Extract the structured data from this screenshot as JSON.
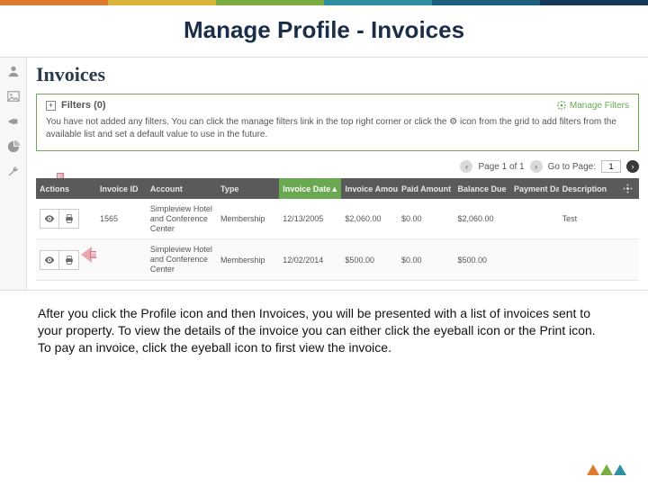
{
  "topbar_colors": [
    "#e07a2d",
    "#d9b43a",
    "#7aac3f",
    "#2f8ea0",
    "#1d5e7e",
    "#153a57"
  ],
  "slide_title": "Manage Profile - Invoices",
  "page_heading": "Invoices",
  "filters": {
    "label": "Filters (0)",
    "manage_label": "Manage Filters",
    "message": "You have not added any filters. You can click the manage filters link in the top right corner or click the ⚙ icon from the grid to add filters from the available list and set a default value to use in the future."
  },
  "paginator": {
    "page_info": "Page 1 of 1",
    "goto_label": "Go to Page:",
    "goto_value": "1"
  },
  "columns": {
    "actions": "Actions",
    "invoice_id": "Invoice ID",
    "account": "Account",
    "type": "Type",
    "invoice_date": "Invoice Date",
    "invoice_amount": "Invoice Amount",
    "paid_amount": "Paid Amount",
    "balance_due": "Balance Due",
    "payment_date": "Payment Date",
    "description": "Description"
  },
  "rows": [
    {
      "invoice_id": "1565",
      "account": "Simpleview Hotel and Conference Center",
      "type": "Membership",
      "invoice_date": "12/13/2005",
      "invoice_amount": "$2,060.00",
      "paid_amount": "$0.00",
      "balance_due": "$2,060.00",
      "payment_date": "",
      "description": "Test"
    },
    {
      "invoice_id": "",
      "account": "Simpleview Hotel and Conference Center",
      "type": "Membership",
      "invoice_date": "12/02/2014",
      "invoice_amount": "$500.00",
      "paid_amount": "$0.00",
      "balance_due": "$500.00",
      "payment_date": "",
      "description": ""
    }
  ],
  "body_text": "After you click the Profile icon and then Invoices, you will be presented with a list of invoices sent to your property. To view the details of the invoice you can either click the eyeball icon or the Print icon.  To pay an invoice, click the eyeball icon to first view the invoice.",
  "logo_colors": [
    "#e07a2d",
    "#7aac3f",
    "#2f8ea0"
  ]
}
